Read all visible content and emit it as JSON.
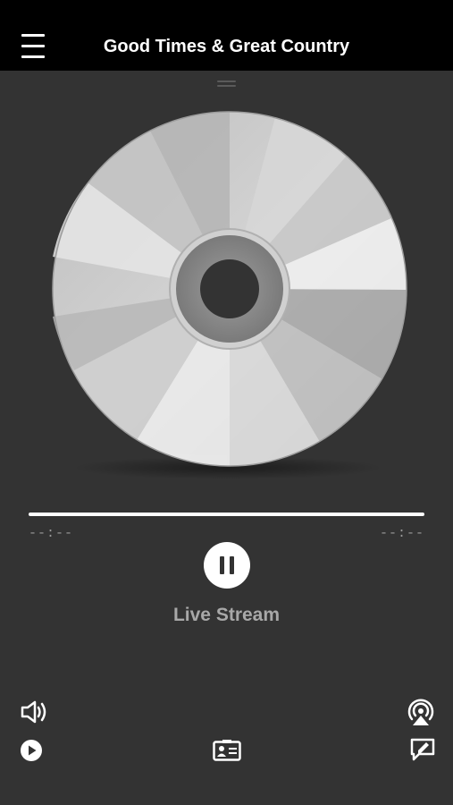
{
  "header": {
    "title": "Good Times & Great Country",
    "menu_icon": "hamburger-menu-icon"
  },
  "artwork": {
    "icon": "compact-disc-artwork"
  },
  "player": {
    "progress": 1.0,
    "elapsed": "--:--",
    "remaining": "--:--",
    "pause_icon": "pause-icon",
    "stream_label": "Live Stream"
  },
  "bottom_controls": {
    "volume_icon": "volume-icon",
    "airplay_icon": "airplay-icon",
    "play_icon": "play-circle-icon",
    "contact_card_icon": "contact-card-icon",
    "feedback_icon": "feedback-edit-icon"
  },
  "colors": {
    "topbar": "#000000",
    "background": "#333333",
    "accent": "#ffffff",
    "secondary_text": "#a8a8a8"
  }
}
